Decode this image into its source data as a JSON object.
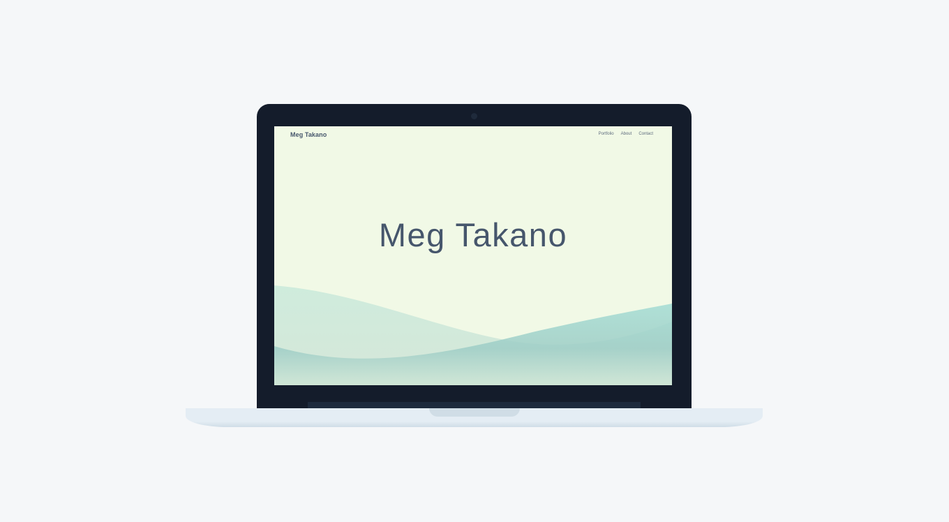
{
  "site": {
    "brand": "Meg Takano",
    "nav": [
      "Portfolio",
      "About",
      "Contact"
    ],
    "hero_title": "Meg Takano"
  },
  "colors": {
    "screen_bg": "#f1f9e6",
    "text": "#46566c",
    "laptop_frame": "#141c2b",
    "page_bg": "#f5f7f9",
    "wave_teal": "#9fd9d1"
  }
}
